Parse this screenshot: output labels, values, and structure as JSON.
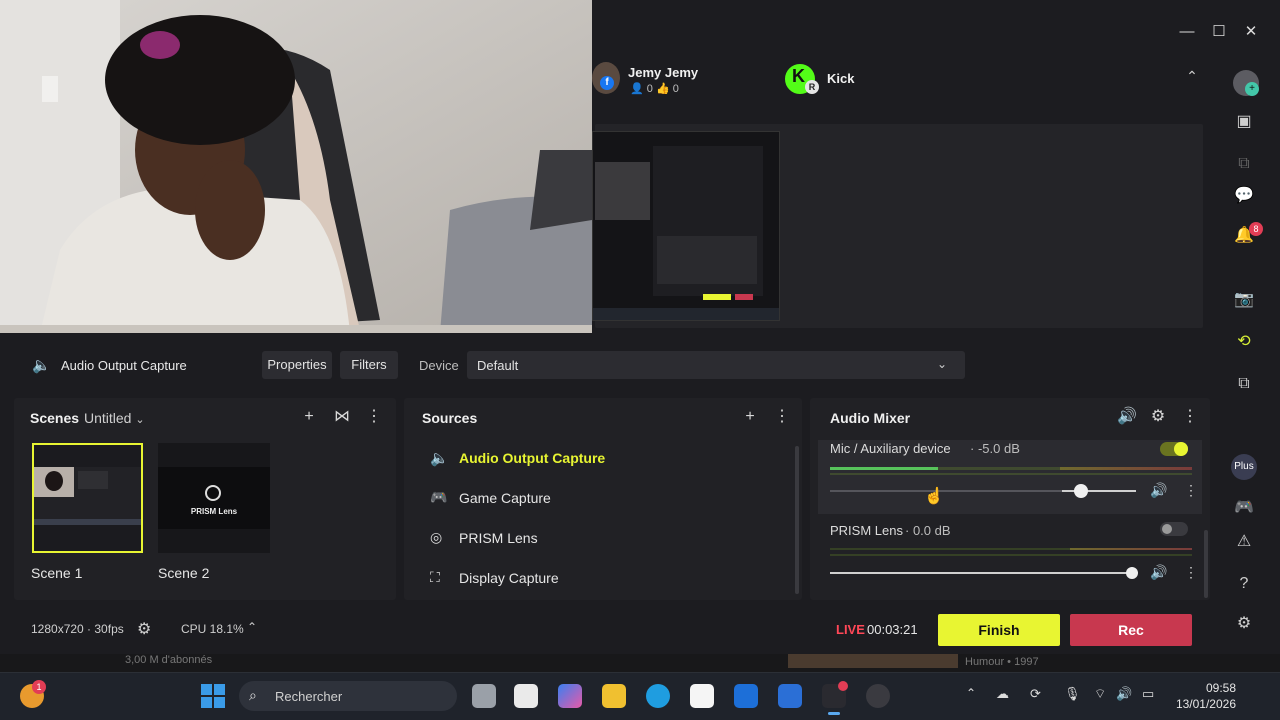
{
  "webcam": {
    "label": "webcam feed"
  },
  "window": {
    "minimize": "—",
    "maximize": "☐",
    "close": "✕"
  },
  "channels": [
    {
      "name": "Jemy Jemy",
      "viewers": "0",
      "likes": "0"
    },
    {
      "name": "Kick"
    }
  ],
  "source_toolbar": {
    "source_name": "Audio Output Capture",
    "properties": "Properties",
    "filters": "Filters",
    "device_label": "Device",
    "device_value": "Default"
  },
  "scenes": {
    "title": "Scenes",
    "collection": "Untitled",
    "items": [
      {
        "label": "Scene 1",
        "thumb_text": ""
      },
      {
        "label": "Scene 2",
        "thumb_text": "PRISM Lens"
      }
    ]
  },
  "sources": {
    "title": "Sources",
    "items": [
      {
        "label": "Audio Output Capture",
        "icon": "speaker-icon",
        "active": true
      },
      {
        "label": "Game Capture",
        "icon": "gamepad-icon",
        "active": false
      },
      {
        "label": "PRISM Lens",
        "icon": "lens-icon",
        "active": false
      },
      {
        "label": "Display Capture",
        "icon": "display-icon",
        "active": false
      }
    ]
  },
  "mixer": {
    "title": "Audio Mixer",
    "channels": [
      {
        "name": "Mic / Auxiliary device",
        "db": "-5.0 dB",
        "level": 0.75,
        "enabled": true
      },
      {
        "name": "PRISM Lens",
        "db": "0.0 dB",
        "level": 1.0,
        "enabled": false
      }
    ]
  },
  "status": {
    "resolution": "1280x720 · 30fps",
    "cpu": "CPU 18.1%",
    "live": "LIVE",
    "timer": "00:03:21",
    "finish": "Finish",
    "rec": "Rec"
  },
  "sidebar": {
    "plus": "Plus",
    "notif_count": "8"
  },
  "taskbar": {
    "search_placeholder": "Rechercher",
    "time": "09:58",
    "date": "13/01/2026",
    "badge": "1"
  },
  "background": {
    "subscribers": "3,00 M d'abonnés",
    "video_meta": "Humour • 1997"
  },
  "colors": {
    "accent": "#e8f532",
    "rec": "#c8384f",
    "live": "#ff4757"
  }
}
